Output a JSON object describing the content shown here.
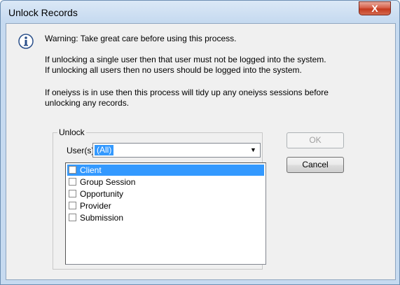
{
  "window": {
    "title": "Unlock Records",
    "close_glyph": "X"
  },
  "message": {
    "icon": "info-icon",
    "warning": "Warning: Take great care before using this process.",
    "single_user": "If unlocking a single user then that user must not be logged into the system.",
    "all_users": "If unlocking all users then no users should be logged into the system.",
    "oneiyss_line1": "If oneiyss is in use then this process will tidy up any oneiyss sessions before",
    "oneiyss_line2": "unlocking any records."
  },
  "unlock_group": {
    "legend": "Unlock",
    "users_label": "User(s):",
    "users_value": "(All)",
    "items": [
      {
        "label": "Client",
        "checked": false,
        "selected": true
      },
      {
        "label": "Group Session",
        "checked": false,
        "selected": false
      },
      {
        "label": "Opportunity",
        "checked": false,
        "selected": false
      },
      {
        "label": "Provider",
        "checked": false,
        "selected": false
      },
      {
        "label": "Submission",
        "checked": false,
        "selected": false
      }
    ]
  },
  "buttons": {
    "ok_label": "OK",
    "ok_enabled": false,
    "cancel_label": "Cancel"
  },
  "colors": {
    "selection": "#3399ff",
    "close_button": "#c43a1f"
  }
}
